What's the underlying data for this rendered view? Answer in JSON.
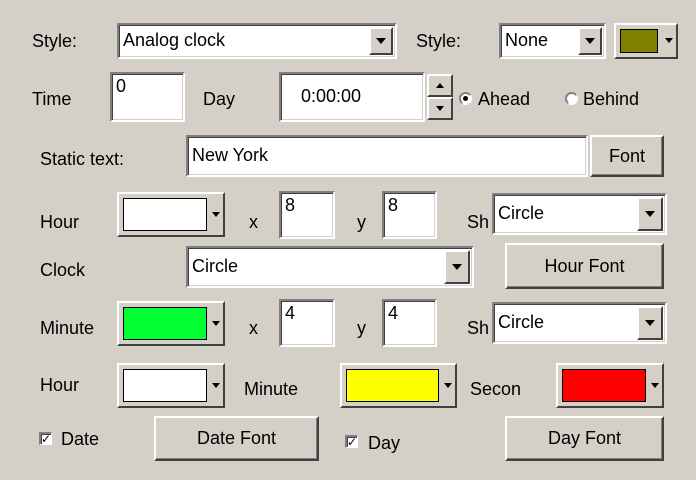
{
  "row1": {
    "style_label": "Style:",
    "style_value": "Analog clock",
    "style2_label": "Style:",
    "style2_value": "None",
    "color": "#808000"
  },
  "row2": {
    "time_label": "Time",
    "time_value": "0",
    "day_label": "Day",
    "day_value": "0:00:00",
    "ahead_label": "Ahead",
    "behind_label": "Behind",
    "selected": "Ahead"
  },
  "row3": {
    "static_label": "Static text:",
    "static_value": "New York",
    "font_button": "Font"
  },
  "row4": {
    "hour_label": "Hour",
    "hour_color": "#ffffff",
    "x_label": "x",
    "x_value": "8",
    "y_label": "y",
    "y_value": "8",
    "sh_label": "Sh",
    "shape_value": "Circle"
  },
  "row5": {
    "clock_label": "Clock",
    "clock_value": "Circle",
    "hour_font_button": "Hour Font"
  },
  "row6": {
    "minute_label": "Minute",
    "minute_color": "#00ff33",
    "x_label": "x",
    "x_value": "4",
    "y_label": "y",
    "y_value": "4",
    "sh_label": "Sh",
    "shape_value": "Circle"
  },
  "row7": {
    "hour_label": "Hour",
    "hour_color": "#ffffff",
    "minute_label": "Minute",
    "minute_color": "#ffff00",
    "second_label": "Secon",
    "second_color": "#ff0000"
  },
  "row8": {
    "date_label": "Date",
    "date_checked": true,
    "date_font_button": "Date Font",
    "day_label": "Day",
    "day_checked": true,
    "day_font_button": "Day Font"
  },
  "colors": {
    "background": "#d4d0c8"
  }
}
